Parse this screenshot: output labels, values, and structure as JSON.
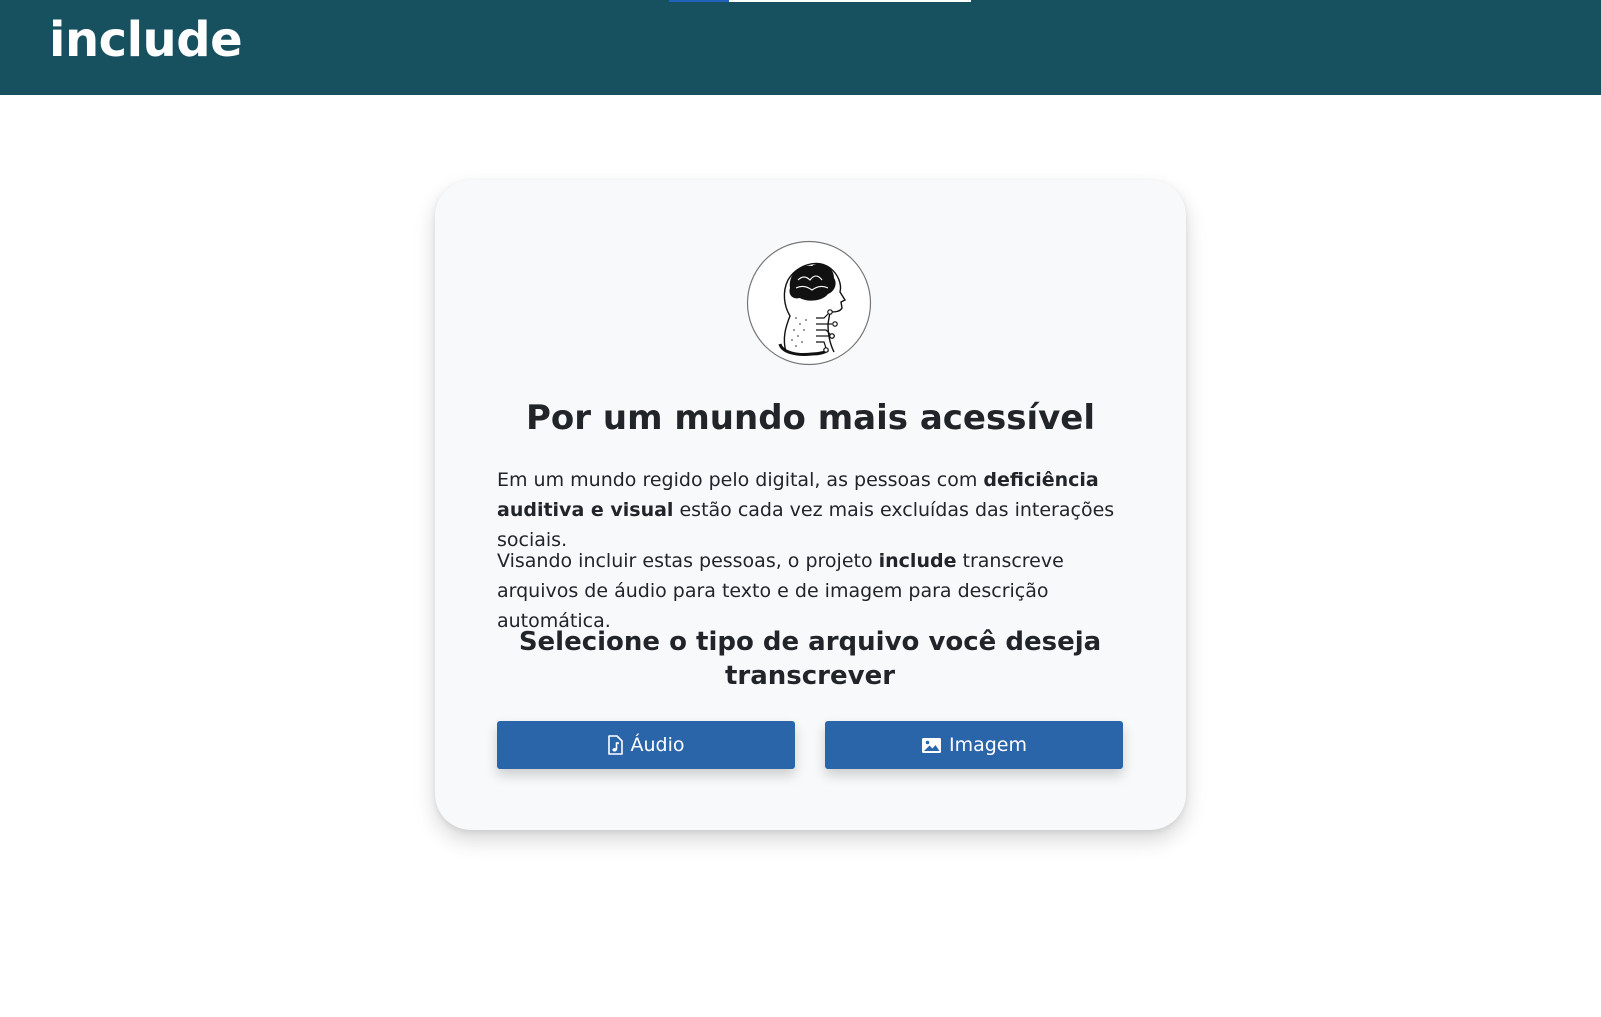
{
  "navbar": {
    "brand": "include",
    "progress_fraction": 0.2,
    "background_color": "#17505e"
  },
  "hero": {
    "logo_icon": "brain-head-circuit-icon",
    "title": "Por um mundo mais acessível",
    "paragraph1": {
      "before": "Em um mundo regido pelo digital, as pessoas com ",
      "bold": "deficiência auditiva e visual",
      "after": " estão cada vez mais excluídas das interações sociais."
    },
    "paragraph2": {
      "before": "Visando incluir estas pessoas, o projeto ",
      "bold": "include",
      "after": " transcreve arquivos de áudio para texto e de imagem para descrição automática."
    },
    "subtitle": "Selecione o tipo de arquivo você deseja transcrever"
  },
  "buttons": {
    "audio_label": "Áudio",
    "audio_icon": "file-music-icon",
    "image_label": "Imagem",
    "image_icon": "image-icon",
    "color": "#2a64a9"
  }
}
